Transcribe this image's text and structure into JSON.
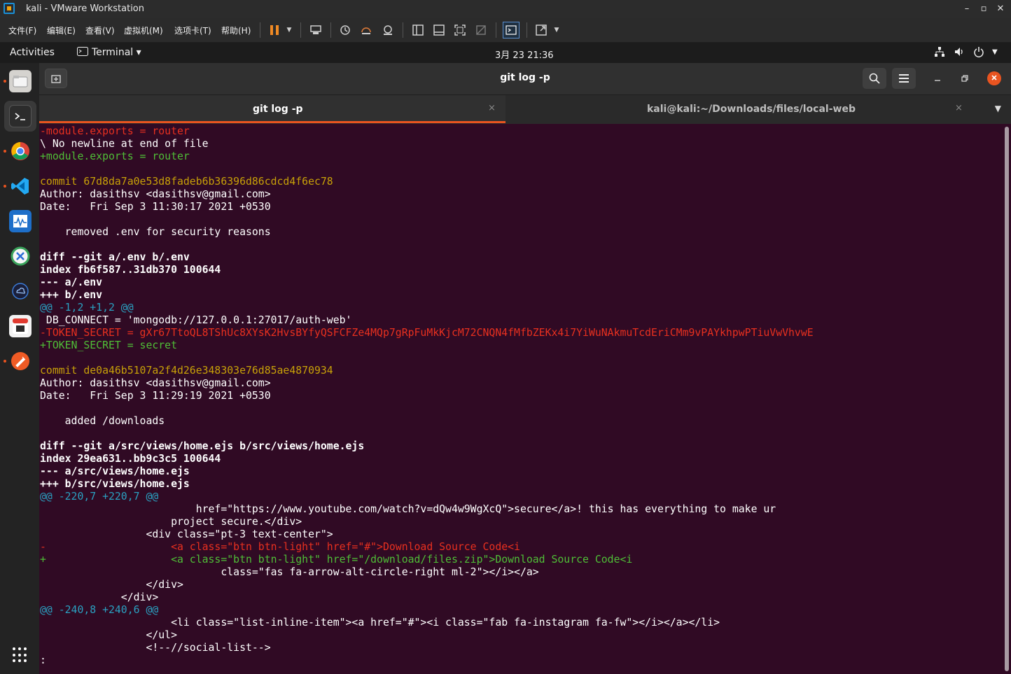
{
  "vmware": {
    "title": "kali - VMware Workstation",
    "menu": [
      "文件(F)",
      "编辑(E)",
      "查看(V)",
      "虚拟机(M)",
      "选项卡(T)",
      "帮助(H)"
    ],
    "win_minimize": "–",
    "win_restore": "▫",
    "win_close": "✕"
  },
  "gnome": {
    "activities": "Activities",
    "app_menu": "Terminal ▾",
    "clock": "3月 23  21:36"
  },
  "terminal": {
    "window_title": "git log -p",
    "tabs": [
      {
        "label": "git log -p",
        "close": "×"
      },
      {
        "label": "kali@kali:~/Downloads/files/local-web",
        "close": "×"
      }
    ],
    "tabs_more": "▼",
    "lines": [
      {
        "text": "-module.exports = router",
        "color": "red"
      },
      {
        "text": "\\ No newline at end of file",
        "color": "white"
      },
      {
        "text": "+module.exports = router",
        "color": "green"
      },
      {
        "text": "",
        "color": "white"
      },
      {
        "text": "commit 67d8da7a0e53d8fadeb6b36396d86cdcd4f6ec78",
        "color": "yellow"
      },
      {
        "text": "Author: dasithsv <dasithsv@gmail.com>",
        "color": "white"
      },
      {
        "text": "Date:   Fri Sep 3 11:30:17 2021 +0530",
        "color": "white"
      },
      {
        "text": "",
        "color": "white"
      },
      {
        "text": "    removed .env for security reasons",
        "color": "white"
      },
      {
        "text": "",
        "color": "white"
      },
      {
        "text": "diff --git a/.env b/.env",
        "color": "bold"
      },
      {
        "text": "index fb6f587..31db370 100644",
        "color": "bold"
      },
      {
        "text": "--- a/.env",
        "color": "bold"
      },
      {
        "text": "+++ b/.env",
        "color": "bold"
      },
      {
        "text": "@@ -1,2 +1,2 @@",
        "color": "cyan"
      },
      {
        "text": " DB_CONNECT = 'mongodb://127.0.0.1:27017/auth-web'",
        "color": "white"
      },
      {
        "text": "-TOKEN_SECRET = gXr67TtoQL8TShUc8XYsK2HvsBYfyQSFCFZe4MQp7gRpFuMkKjcM72CNQN4fMfbZEKx4i7YiWuNAkmuTcdEriCMm9vPAYkhpwPTiuVwVhvwE",
        "color": "red"
      },
      {
        "text": "+TOKEN_SECRET = secret",
        "color": "green"
      },
      {
        "text": "",
        "color": "white"
      },
      {
        "text": "commit de0a46b5107a2f4d26e348303e76d85ae4870934",
        "color": "yellow"
      },
      {
        "text": "Author: dasithsv <dasithsv@gmail.com>",
        "color": "white"
      },
      {
        "text": "Date:   Fri Sep 3 11:29:19 2021 +0530",
        "color": "white"
      },
      {
        "text": "",
        "color": "white"
      },
      {
        "text": "    added /downloads",
        "color": "white"
      },
      {
        "text": "",
        "color": "white"
      },
      {
        "text": "diff --git a/src/views/home.ejs b/src/views/home.ejs",
        "color": "bold"
      },
      {
        "text": "index 29ea631..bb9c3c5 100644",
        "color": "bold"
      },
      {
        "text": "--- a/src/views/home.ejs",
        "color": "bold"
      },
      {
        "text": "+++ b/src/views/home.ejs",
        "color": "bold"
      },
      {
        "text": "@@ -220,7 +220,7 @@",
        "color": "cyan"
      },
      {
        "text": "                         href=\"https://www.youtube.com/watch?v=dQw4w9WgXcQ\">secure</a>! this has everything to make ur",
        "color": "white"
      },
      {
        "text": "                     project secure.</div>",
        "color": "white"
      },
      {
        "text": "                 <div class=\"pt-3 text-center\">",
        "color": "white"
      },
      {
        "text": "-                    <a class=\"btn btn-light\" href=\"#\">Download Source Code<i",
        "color": "red"
      },
      {
        "text": "+                    <a class=\"btn btn-light\" href=\"/download/files.zip\">Download Source Code<i",
        "color": "green"
      },
      {
        "text": "                             class=\"fas fa-arrow-alt-circle-right ml-2\"></i></a>",
        "color": "white"
      },
      {
        "text": "                 </div>",
        "color": "white"
      },
      {
        "text": "             </div>",
        "color": "white"
      },
      {
        "text": "@@ -240,8 +240,6 @@",
        "color": "cyan"
      },
      {
        "text": "                     <li class=\"list-inline-item\"><a href=\"#\"><i class=\"fab fa-instagram fa-fw\"></i></a></li>",
        "color": "white"
      },
      {
        "text": "                 </ul>",
        "color": "white"
      },
      {
        "text": "                 <!--//social-list-->",
        "color": "white"
      },
      {
        "text": ":",
        "color": "white"
      }
    ]
  }
}
